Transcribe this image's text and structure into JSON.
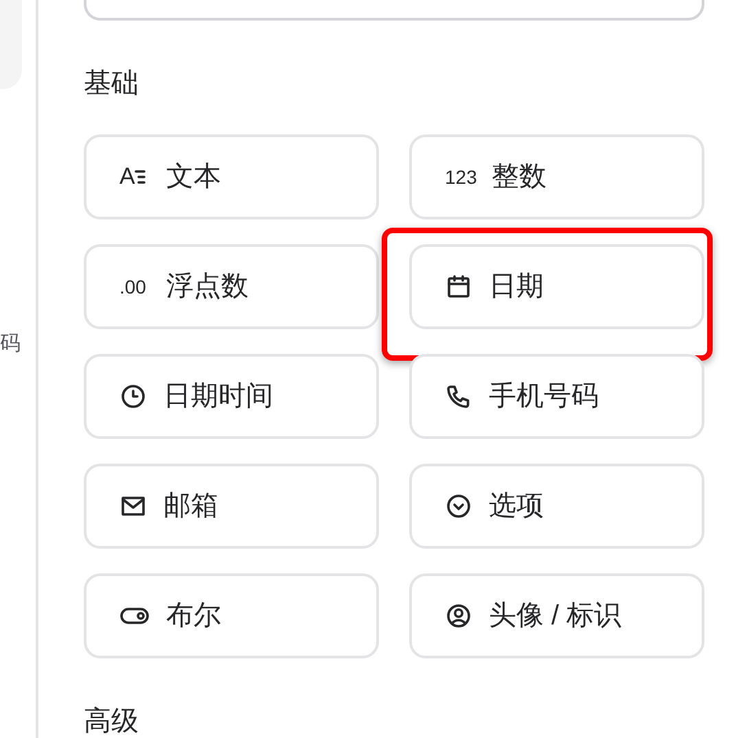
{
  "sidebar": {
    "items": [
      {
        "label": "码"
      }
    ]
  },
  "sections": [
    {
      "title": "基础",
      "items": [
        {
          "kind": "text",
          "glyph": "A",
          "label": "文本",
          "highlighted": false
        },
        {
          "kind": "integer",
          "glyph": "123",
          "label": "整数",
          "highlighted": false
        },
        {
          "kind": "float",
          "glyph": ".00",
          "label": "浮点数",
          "highlighted": false
        },
        {
          "kind": "date",
          "label": "日期",
          "highlighted": true
        },
        {
          "kind": "datetime",
          "label": "日期时间",
          "highlighted": false
        },
        {
          "kind": "phone",
          "label": "手机号码",
          "highlighted": false
        },
        {
          "kind": "email",
          "label": "邮箱",
          "highlighted": false
        },
        {
          "kind": "select",
          "label": "选项",
          "highlighted": false
        },
        {
          "kind": "boolean",
          "label": "布尔",
          "highlighted": false
        },
        {
          "kind": "avatar",
          "label": "头像 / 标识",
          "highlighted": false
        }
      ]
    },
    {
      "title": "高级"
    }
  ]
}
